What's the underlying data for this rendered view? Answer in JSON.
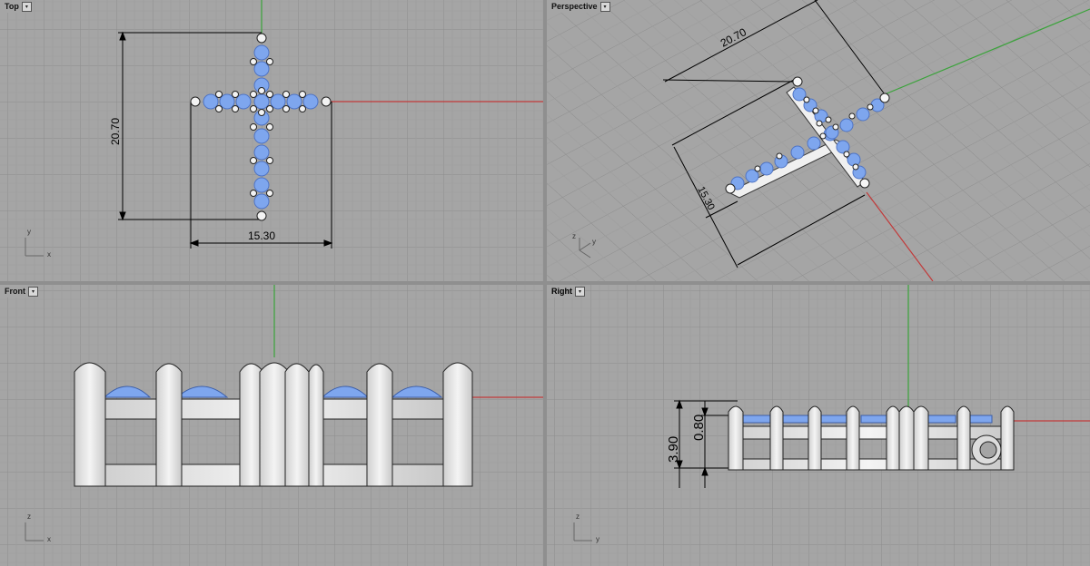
{
  "viewports": {
    "top": {
      "title": "Top",
      "dims": {
        "height": "20.70",
        "width": "15.30"
      },
      "axis": {
        "v": "y",
        "h": "x"
      }
    },
    "perspective": {
      "title": "Perspective",
      "dims": {
        "length": "20.70",
        "width": "15.30"
      },
      "axis": {
        "v": "z",
        "h": "y"
      }
    },
    "front": {
      "title": "Front",
      "axis": {
        "v": "z",
        "h": "x"
      }
    },
    "right": {
      "title": "Right",
      "dims": {
        "height_total": "3.90",
        "height_top": "0.80"
      },
      "axis": {
        "v": "z",
        "h": "y"
      }
    }
  },
  "colors": {
    "viewport_bg": "#a5a5a5",
    "grid_minor": "#9c9c9c",
    "grid_major": "#8a8a8a",
    "axis_x": "#c23a3a",
    "axis_y": "#3aa33a",
    "gem": "#7ea6ee",
    "metal": "#e9e9e9"
  }
}
